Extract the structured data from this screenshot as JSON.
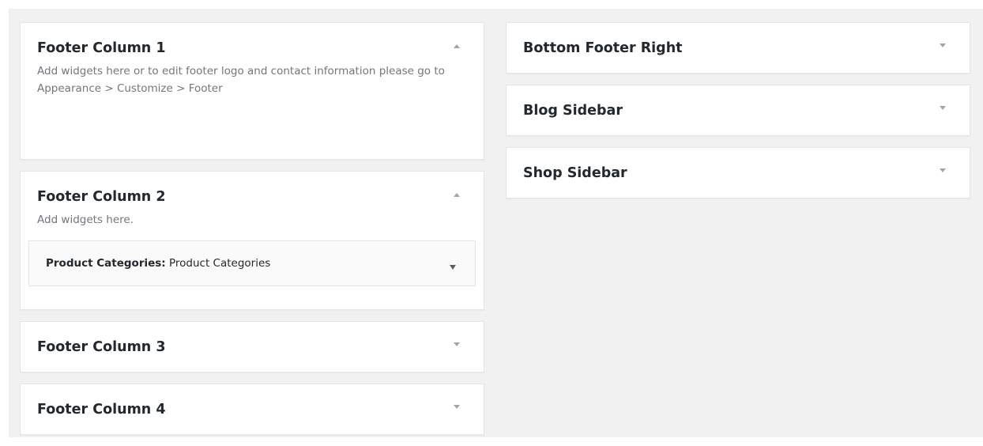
{
  "left_sidebars": [
    {
      "title": "Footer Column 1",
      "description": "Add widgets here or to edit footer logo and contact information please go to Appearance > Customize > Footer",
      "toggle_icon": "arrow-up-icon"
    },
    {
      "title": "Footer Column 2",
      "description": "Add widgets here.",
      "toggle_icon": "arrow-up-icon",
      "widget": {
        "name": "Product Categories:",
        "instance_title": "Product Categories",
        "toggle_icon": "arrow-down-icon"
      }
    },
    {
      "title": "Footer Column 3",
      "toggle_icon": "arrow-down-icon"
    },
    {
      "title": "Footer Column 4",
      "toggle_icon": "arrow-down-icon"
    }
  ],
  "right_sidebars": [
    {
      "title": "Bottom Footer Right",
      "toggle_icon": "arrow-down-icon"
    },
    {
      "title": "Blog Sidebar",
      "toggle_icon": "arrow-down-icon"
    },
    {
      "title": "Shop Sidebar",
      "toggle_icon": "arrow-down-icon"
    }
  ],
  "colors": {
    "background": "#f1f1f1",
    "panel": "#ffffff",
    "border": "#e5e5e5",
    "title_text": "#23282d",
    "description_text": "#72777c",
    "arrow_light": "#a0a5aa",
    "arrow_dark": "#555d66"
  }
}
